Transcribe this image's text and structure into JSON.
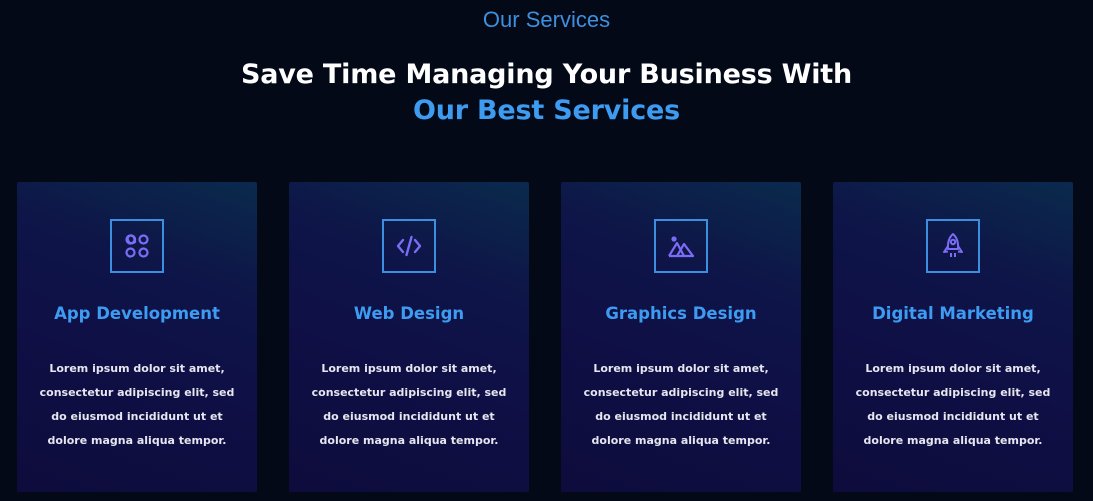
{
  "section": {
    "eyebrow": "Our Services",
    "title_line1": "Save Time Managing Your Business With",
    "title_line2": "Our Best Services"
  },
  "colors": {
    "background": "#030916",
    "accent": "#3d9cf2",
    "icon_stroke": "#7b6cf6",
    "icon_border": "#3b8ee0"
  },
  "services": [
    {
      "icon": "apps-icon",
      "title": "App Development",
      "description": "Lorem ipsum dolor sit amet, consectetur adipiscing elit, sed do eiusmod incididunt ut et dolore magna aliqua tempor."
    },
    {
      "icon": "code-icon",
      "title": "Web Design",
      "description": "Lorem ipsum dolor sit amet, consectetur adipiscing elit, sed do eiusmod incididunt ut et dolore magna aliqua tempor."
    },
    {
      "icon": "image-icon",
      "title": "Graphics Design",
      "description": "Lorem ipsum dolor sit amet, consectetur adipiscing elit, sed do eiusmod incididunt ut et dolore magna aliqua tempor."
    },
    {
      "icon": "rocket-icon",
      "title": "Digital Marketing",
      "description": "Lorem ipsum dolor sit amet, consectetur adipiscing elit, sed do eiusmod incididunt ut et dolore magna aliqua tempor."
    }
  ]
}
